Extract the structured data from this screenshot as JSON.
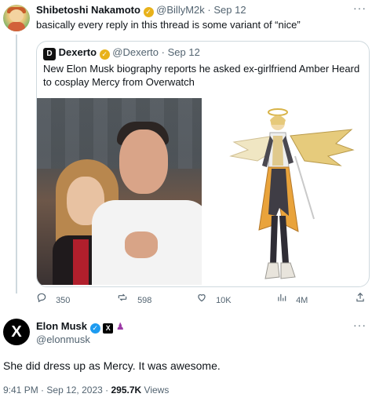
{
  "reply": {
    "author_name": "Shibetoshi Nakamoto",
    "author_handle": "@BillyM2k",
    "separator": "·",
    "date": "Sep 12",
    "text": "basically every reply in this thread is some variant of “nice”"
  },
  "quoted": {
    "author_name": "Dexerto",
    "author_handle": "@Dexerto",
    "separator": "·",
    "date": "Sep 12",
    "text": "New Elon Musk biography reports he asked ex-girlfriend Amber Heard to cosplay Mercy from Overwatch",
    "logo_glyph": "D"
  },
  "reply_actions": {
    "replies": "350",
    "reposts": "598",
    "likes": "10K",
    "views": "4M"
  },
  "main": {
    "author_name": "Elon Musk",
    "author_handle": "@elonmusk",
    "avatar_glyph": "X",
    "text": "She did dress up as Mercy. It was awesome.",
    "time": "9:41 PM",
    "separator": "·",
    "date": "Sep 12, 2023",
    "separator2": "·",
    "views_count": "295.7K",
    "views_label": "Views"
  },
  "colors": {
    "muted": "#536471",
    "gold_verified": "#e8b21b",
    "blue_verified": "#1d9bf0",
    "border": "#cfd9de"
  }
}
